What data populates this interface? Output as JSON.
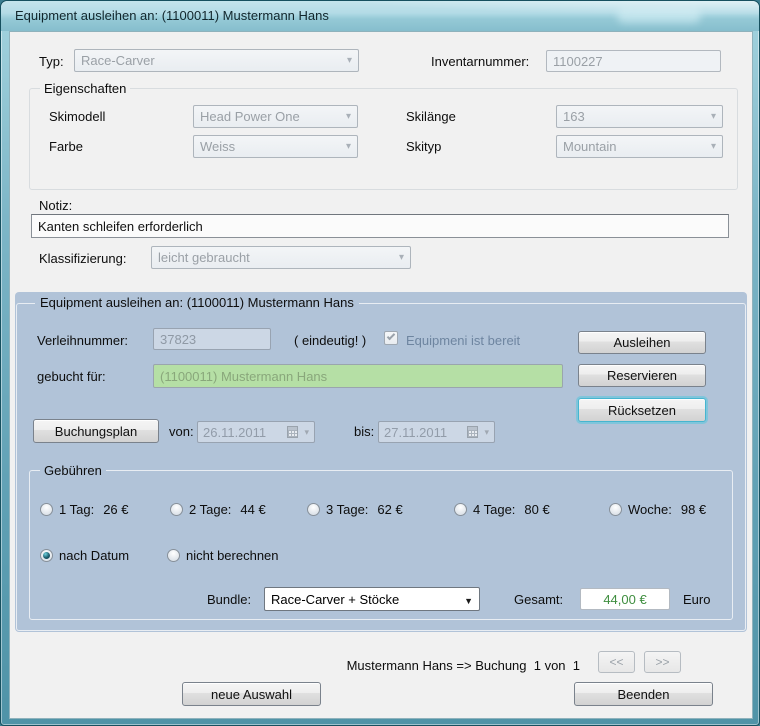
{
  "window": {
    "title": "Equipment ausleihen an: (1100011) Mustermann Hans"
  },
  "header": {
    "typ_label": "Typ:",
    "typ_value": "Race-Carver",
    "inventarnummer_label": "Inventarnummer:",
    "inventarnummer_value": "1100227"
  },
  "eigenschaften": {
    "title": "Eigenschaften",
    "skimodell_label": "Skimodell",
    "skimodell_value": "Head Power One",
    "skilaenge_label": "Skilänge",
    "skilaenge_value": "163",
    "farbe_label": "Farbe",
    "farbe_value": "Weiss",
    "skityp_label": "Skityp",
    "skityp_value": "Mountain"
  },
  "notiz": {
    "label": "Notiz:",
    "value": "Kanten schleifen erforderlich"
  },
  "klassifizierung": {
    "label": "Klassifizierung:",
    "value": "leicht gebraucht"
  },
  "panel": {
    "title": "Equipment ausleihen an: (1100011) Mustermann Hans",
    "verleihnummer_label": "Verleihnummer:",
    "verleihnummer_value": "37823",
    "eindeutig_hint": "( eindeutig! )",
    "bereit_checkbox_label": "Equipmeni ist bereit",
    "gebucht_fuer_label": "gebucht für:",
    "gebucht_fuer_value": "(1100011) Mustermann Hans",
    "ausleihen_button": "Ausleihen",
    "reservieren_button": "Reservieren",
    "ruecksetzen_button": "Rücksetzen",
    "buchungsplan_button": "Buchungsplan",
    "von_label": "von:",
    "von_value": "26.11.2011",
    "bis_label": "bis:",
    "bis_value": "27.11.2011",
    "gebuehren": {
      "title": "Gebühren",
      "options": [
        {
          "label": "1 Tag:",
          "price": "26 €"
        },
        {
          "label": "2 Tage:",
          "price": "44 €"
        },
        {
          "label": "3 Tage:",
          "price": "62 €"
        },
        {
          "label": "4 Tage:",
          "price": "80 €"
        },
        {
          "label": "Woche:",
          "price": "98 €"
        }
      ],
      "nach_datum_label": "nach Datum",
      "nicht_berechnen_label": "nicht berechnen",
      "bundle_label": "Bundle:",
      "bundle_value": "Race-Carver + Stöcke",
      "gesamt_label": "Gesamt:",
      "gesamt_value": "44,00 €",
      "euro_label": "Euro"
    }
  },
  "footer": {
    "status": "Mustermann Hans => Buchung  1 von  1",
    "prev_button": "<<",
    "next_button": ">>",
    "neue_auswahl_button": "neue Auswahl",
    "beenden_button": "Beenden"
  },
  "colors": {
    "panel_blue": "#b1c3d8",
    "booked_field_green": "#b5dfa5",
    "total_text_green": "#3f8e3f",
    "titlebar_teal": "#a9d6e2"
  }
}
